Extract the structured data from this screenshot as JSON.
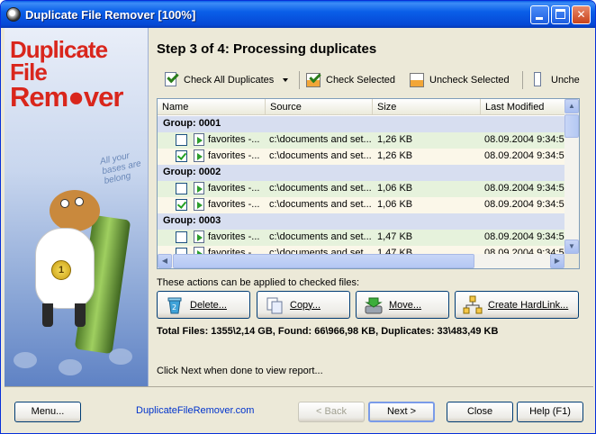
{
  "window": {
    "title": "Duplicate File Remover [100%]"
  },
  "sidebar": {
    "logo_line1": "Duplicate File",
    "logo_line2": "Rem●ver",
    "wall_text": "All your bases are belong"
  },
  "main": {
    "step_title": "Step 3 of 4: Processing duplicates",
    "toolbar": {
      "check_all": "Check All Duplicates",
      "check_selected": "Check Selected",
      "uncheck_selected": "Uncheck Selected",
      "uncheck_truncated": "Unche"
    },
    "columns": [
      "Name",
      "Source",
      "Size",
      "Last Modified"
    ],
    "groups": [
      {
        "label": "Group: 0001",
        "items": [
          {
            "checked": false,
            "name": "favorites -...",
            "source": "c:\\documents and set...",
            "size": "1,26 KB",
            "modified": "08.09.2004 9:34:5"
          },
          {
            "checked": true,
            "name": "favorites -...",
            "source": "c:\\documents and set...",
            "size": "1,26 KB",
            "modified": "08.09.2004 9:34:5"
          }
        ]
      },
      {
        "label": "Group: 0002",
        "items": [
          {
            "checked": false,
            "name": "favorites -...",
            "source": "c:\\documents and set...",
            "size": "1,06 KB",
            "modified": "08.09.2004 9:34:5"
          },
          {
            "checked": true,
            "name": "favorites -...",
            "source": "c:\\documents and set...",
            "size": "1,06 KB",
            "modified": "08.09.2004 9:34:5"
          }
        ]
      },
      {
        "label": "Group: 0003",
        "items": [
          {
            "checked": false,
            "name": "favorites -...",
            "source": "c:\\documents and set...",
            "size": "1,47 KB",
            "modified": "08.09.2004 9:34:5"
          },
          {
            "checked": false,
            "name": "favorites -...",
            "source": "c:\\documents and set...",
            "size": "1,47 KB",
            "modified": "08.09.2004 9:34:5"
          }
        ]
      }
    ],
    "actions_label": "These actions can be applied to checked files:",
    "actions": {
      "delete": "Delete...",
      "copy": "Copy...",
      "move": "Move...",
      "hardlink": "Create HardLink..."
    },
    "stats": "Total Files: 1355\\2,14 GB, Found: 66\\966,98 KB, Duplicates: 33\\483,49 KB",
    "hint": "Click Next when done to view report..."
  },
  "footer": {
    "menu": "Menu...",
    "website": "DuplicateFileRemover.com",
    "back": "< Back",
    "next": "Next >",
    "close": "Close",
    "help": "Help (F1)"
  },
  "colors": {
    "titlebar": "#0a5fe8",
    "logo_red": "#d9261c",
    "group_row": "#d7def0",
    "item_row": "#e6f2dc"
  }
}
